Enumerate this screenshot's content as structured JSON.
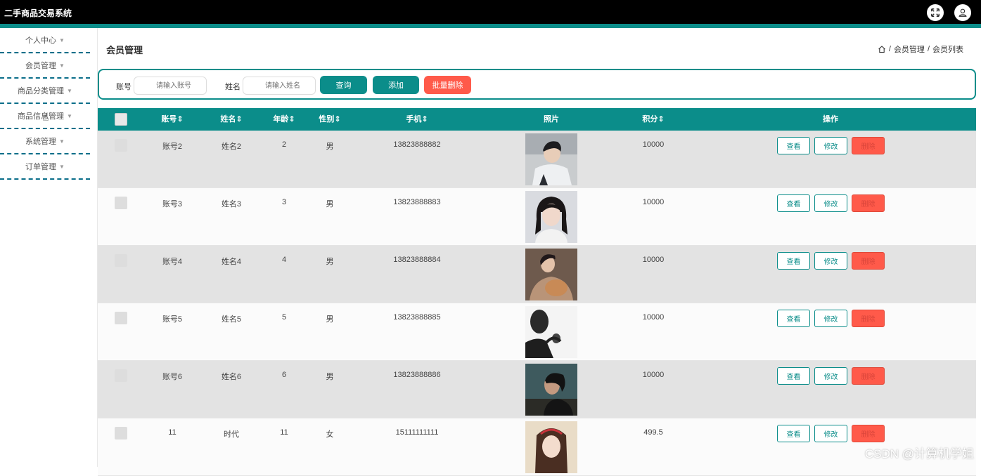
{
  "app": {
    "title": "二手商品交易系统"
  },
  "sidebar": {
    "items": [
      {
        "label": "个人中心"
      },
      {
        "label": "会员管理"
      },
      {
        "label": "商品分类管理"
      },
      {
        "label": "商品信息管理"
      },
      {
        "label": "系统管理"
      },
      {
        "label": "订单管理"
      }
    ]
  },
  "header": {
    "page_title": "会员管理",
    "breadcrumb": [
      "会员管理",
      "会员列表"
    ],
    "breadcrumb_sep": "/"
  },
  "search": {
    "account_label": "账号",
    "account_placeholder": "请输入账号",
    "name_label": "姓名",
    "name_placeholder": "请输入姓名",
    "query_btn": "查询",
    "add_btn": "添加",
    "batch_delete_btn": "批量删除"
  },
  "table": {
    "columns": [
      "账号",
      "姓名",
      "年龄",
      "性别",
      "手机",
      "照片",
      "积分",
      "操作"
    ],
    "sort_mark": "⇕",
    "actions": {
      "view": "查看",
      "edit": "修改",
      "delete": "删除"
    },
    "rows": [
      {
        "account": "账号2",
        "name": "姓名2",
        "age": "2",
        "gender": "男",
        "phone": "13823888882",
        "points": "10000",
        "photo": "male-portrait-white-jacket"
      },
      {
        "account": "账号3",
        "name": "姓名3",
        "age": "3",
        "gender": "男",
        "phone": "13823888883",
        "points": "10000",
        "photo": "female-portrait-dark-hair"
      },
      {
        "account": "账号4",
        "name": "姓名4",
        "age": "4",
        "gender": "男",
        "phone": "13823888884",
        "points": "10000",
        "photo": "male-portrait-with-dog"
      },
      {
        "account": "账号5",
        "name": "姓名5",
        "age": "5",
        "gender": "男",
        "phone": "13823888885",
        "points": "10000",
        "photo": "male-silhouette-bw"
      },
      {
        "account": "账号6",
        "name": "姓名6",
        "age": "6",
        "gender": "男",
        "phone": "13823888886",
        "points": "10000",
        "photo": "male-profile-dusk"
      },
      {
        "account": "11",
        "name": "时代",
        "age": "11",
        "gender": "女",
        "phone": "15111111111",
        "points": "499.5",
        "photo": "female-portrait-red-headband"
      }
    ]
  },
  "watermark": "CSDN @计算机学姐",
  "colors": {
    "accent": "#0b8d8a",
    "danger": "#ff5a4a",
    "topbar": "#000000"
  }
}
